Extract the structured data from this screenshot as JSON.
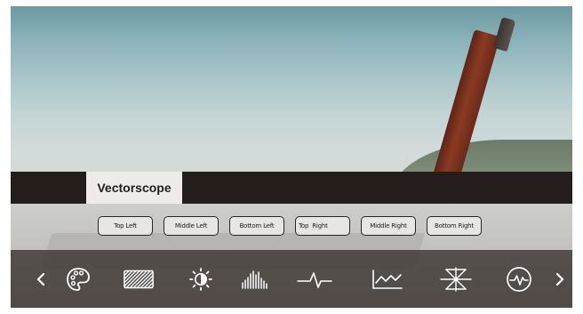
{
  "monitor": {
    "title": "Vectorscope",
    "positions": [
      {
        "label": "Top Left"
      },
      {
        "label": "Middle Left"
      },
      {
        "label": "Bottom Left"
      },
      {
        "label": "Top  Right"
      },
      {
        "label": "Middle Right"
      },
      {
        "label": "Bottom Right"
      }
    ],
    "toolbar": {
      "tools": [
        {
          "icon": "palette-icon"
        },
        {
          "icon": "zebra-pattern-icon"
        },
        {
          "icon": "brightness-icon"
        },
        {
          "icon": "histogram-icon"
        },
        {
          "icon": "waveform-icon"
        },
        {
          "icon": "line-graph-icon"
        },
        {
          "icon": "vectorscope-icon"
        },
        {
          "icon": "heart-rate-icon"
        }
      ],
      "prev": "<",
      "next": ">"
    },
    "colors": {
      "title_bar": "#231e1c",
      "title_tab": "#efebe8",
      "toolbar": "#48423f",
      "icon": "#ffffff"
    }
  }
}
